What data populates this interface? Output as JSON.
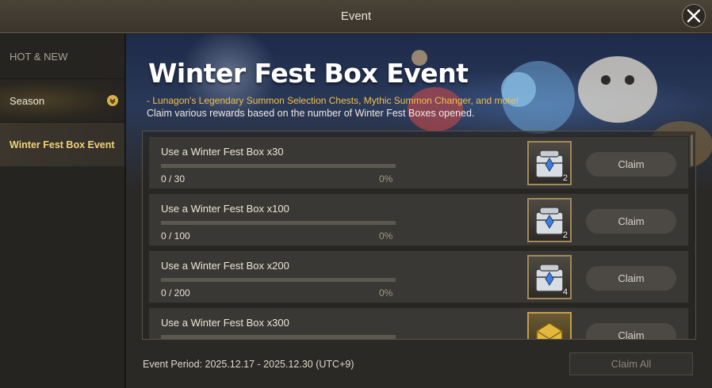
{
  "window": {
    "title": "Event"
  },
  "sidebar": {
    "items": [
      {
        "label": "HOT & NEW"
      },
      {
        "label": "Season"
      },
      {
        "label": "Winter Fest Box Event"
      }
    ]
  },
  "banner": {
    "title": "Winter Fest Box Event",
    "subtitle": "- Lunagon's Legendary Summon Selection Chests, Mythic Summon Changer, and more!",
    "description": "Claim various rewards based on the number of Winter Fest Boxes opened."
  },
  "tasks": [
    {
      "label": "Use a Winter Fest Box x30",
      "count": "0 / 30",
      "percent": "0%",
      "progress": 0,
      "reward_qty": "2",
      "reward_icon": "silver-chest-icon",
      "claim": "Claim"
    },
    {
      "label": "Use a Winter Fest Box x100",
      "count": "0 / 100",
      "percent": "0%",
      "progress": 0,
      "reward_qty": "2",
      "reward_icon": "silver-chest-icon",
      "claim": "Claim"
    },
    {
      "label": "Use a Winter Fest Box x200",
      "count": "0 / 200",
      "percent": "0%",
      "progress": 0,
      "reward_qty": "4",
      "reward_icon": "silver-chest-icon",
      "claim": "Claim"
    },
    {
      "label": "Use a Winter Fest Box x300",
      "count": "",
      "percent": "",
      "progress": 0,
      "reward_qty": "",
      "reward_icon": "gold-chest-icon",
      "claim": "Claim"
    }
  ],
  "footer": {
    "period": "Event Period: 2025.12.17 - 2025.12.30 (UTC+9)",
    "claim_all": "Claim All"
  },
  "colors": {
    "accent": "#f2c04a",
    "selected": "#f2d37a"
  }
}
